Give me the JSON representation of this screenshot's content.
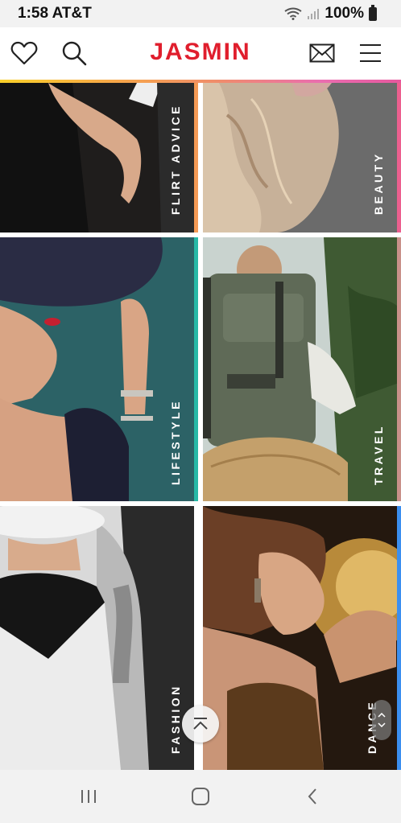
{
  "status_bar": {
    "time": "1:58 AT&T",
    "battery": "100%"
  },
  "header": {
    "brand": "JASMIN",
    "brand_color": "#e01e2d",
    "icons": [
      "heart-icon",
      "search-icon",
      "mail-icon",
      "menu-icon"
    ]
  },
  "categories": [
    {
      "label": "FLIRT ADVICE",
      "accent": "#f49a55"
    },
    {
      "label": "BEAUTY",
      "accent": "#ec5f8f"
    },
    {
      "label": "LIFESTYLE",
      "accent": "#26b8a6"
    },
    {
      "label": "TRAVEL",
      "accent": "#c9918a"
    },
    {
      "label": "FASHION",
      "accent": "#ffffff"
    },
    {
      "label": "DANCE",
      "accent": "#3b8ff0"
    }
  ],
  "nav": {
    "icons": [
      "recent-apps-icon",
      "home-icon",
      "back-icon"
    ]
  }
}
